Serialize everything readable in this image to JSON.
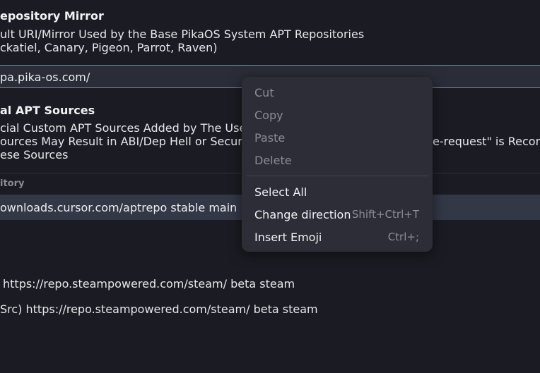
{
  "mirror_section": {
    "title": "epository Mirror",
    "description_line1": "ult URI/Mirror Used by the Base PikaOS System APT Repositories",
    "description_line2": "ckatiel, Canary, Pigeon, Parrot, Raven)",
    "entry_value": "pa.pika-os.com/"
  },
  "sources_section": {
    "title": "al APT Sources",
    "description_line1": "cial Custom APT Sources Added by The User",
    "description_line2_left": "ources May Result in ABI/Dep Hell or Security",
    "description_line2_right": "e-request\" is Recom",
    "description_line3": "ese Sources",
    "column_header": "itory",
    "rows": [
      "ownloads.cursor.com/aptrepo stable main",
      "",
      "https://repo.steampowered.com/steam/ beta steam",
      "Src) https://repo.steampowered.com/steam/ beta steam"
    ]
  },
  "context_menu": {
    "items": [
      {
        "label": "Cut",
        "accel": "",
        "enabled": false
      },
      {
        "label": "Copy",
        "accel": "",
        "enabled": false
      },
      {
        "label": "Paste",
        "accel": "",
        "enabled": false
      },
      {
        "label": "Delete",
        "accel": "",
        "enabled": false
      },
      {
        "label": "Select All",
        "accel": "",
        "enabled": true
      },
      {
        "label": "Change direction",
        "accel": "Shift+Ctrl+T",
        "enabled": true
      },
      {
        "label": "Insert Emoji",
        "accel": "Ctrl+;",
        "enabled": true
      }
    ]
  }
}
